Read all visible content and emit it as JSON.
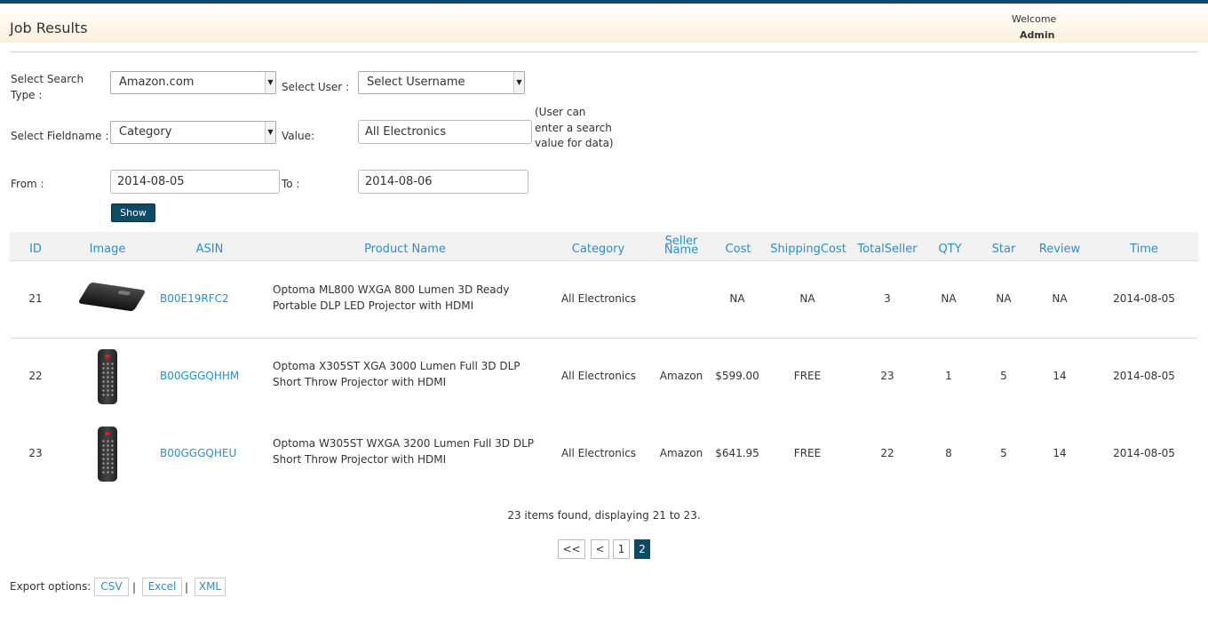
{
  "header": {
    "title": "Job Results",
    "welcome": "Welcome",
    "user": "Admin"
  },
  "filters": {
    "search_type_label": "Select Search Type :",
    "search_type_value": "Amazon.com",
    "user_label": "Select User :",
    "user_value": "Select Username",
    "fieldname_label": "Select Fieldname :",
    "fieldname_value": "Category",
    "value_label": "Value:",
    "value_value": "All Electronics",
    "value_hint": "(User can enter a search value for data)",
    "from_label": "From :",
    "from_value": "2014-08-05",
    "to_label": "To :",
    "to_value": "2014-08-06",
    "show_label": "Show"
  },
  "table": {
    "columns": [
      "ID",
      "Image",
      "ASIN",
      "Product Name",
      "Category",
      "Seller Name",
      "Cost",
      "ShippingCost",
      "TotalSeller",
      "QTY",
      "Star",
      "Review",
      "Time"
    ],
    "rows": [
      {
        "id": "21",
        "image": "projector-image",
        "asin": "B00E19RFC2",
        "product": "Optoma ML800 WXGA 800 Lumen 3D Ready Portable DLP LED Projector with HDMI",
        "category": "All Electronics",
        "seller": "",
        "cost": "NA",
        "shipping": "NA",
        "total_seller": "3",
        "qty": "NA",
        "star": "NA",
        "review": "NA",
        "time": "2014-08-05"
      },
      {
        "id": "22",
        "image": "remote-image",
        "asin": "B00GGGQHHM",
        "product": "Optoma X305ST XGA 3000 Lumen Full 3D DLP Short Throw Projector with HDMI",
        "category": "All Electronics",
        "seller": "Amazon",
        "cost": "$599.00",
        "shipping": "FREE",
        "total_seller": "23",
        "qty": "1",
        "star": "5",
        "review": "14",
        "time": "2014-08-05"
      },
      {
        "id": "23",
        "image": "remote-image",
        "asin": "B00GGGQHEU",
        "product": "Optoma W305ST WXGA 3200 Lumen Full 3D DLP Short Throw Projector with HDMI",
        "category": "All Electronics",
        "seller": "Amazon",
        "cost": "$641.95",
        "shipping": "FREE",
        "total_seller": "22",
        "qty": "8",
        "star": "5",
        "review": "14",
        "time": "2014-08-05"
      }
    ]
  },
  "pagination": {
    "summary": "23 items found, displaying 21 to 23.",
    "first": "<<",
    "prev": "<",
    "pages": [
      "1",
      "2"
    ],
    "current": "2"
  },
  "export": {
    "label": "Export options:",
    "options": [
      "CSV",
      "Excel",
      "XML"
    ],
    "separator": "|"
  },
  "colors": {
    "accent": "#0d4a66",
    "link": "#2a8fc8"
  }
}
